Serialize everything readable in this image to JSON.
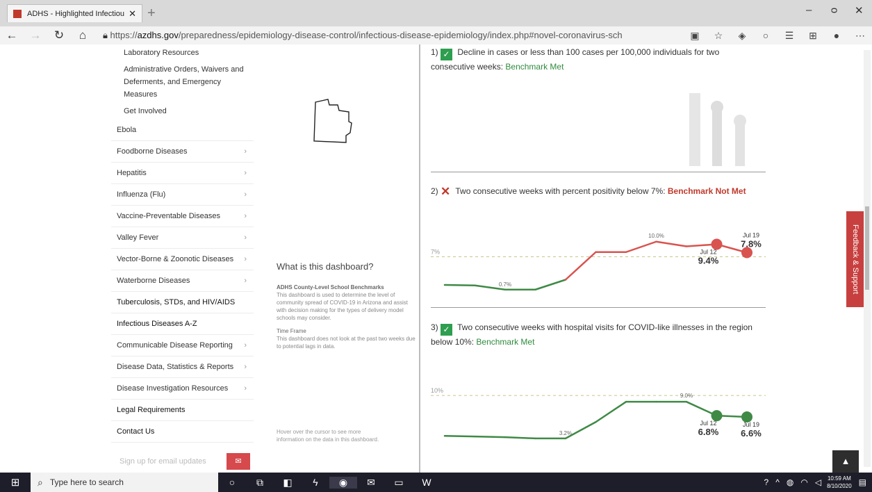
{
  "browser": {
    "tab_title": "ADHS - Highlighted Infectious D",
    "new_tab": "+",
    "url_prefix": "https://",
    "url_domain": "azdhs.gov",
    "url_rest": "/preparedness/epidemiology-disease-control/infectious-disease-epidemiology/index.php#novel-coronavirus-sch",
    "minimize": "–",
    "restore": "ᴑ",
    "close": "✕"
  },
  "sidebar": {
    "subitems": [
      "Laboratory Resources",
      "Administrative Orders, Waivers and Deferments, and Emergency Measures",
      "Get Involved"
    ],
    "items": [
      {
        "label": "Ebola",
        "chevron": ""
      },
      {
        "label": "Foodborne Diseases",
        "chevron": "›"
      },
      {
        "label": "Hepatitis",
        "chevron": "›"
      },
      {
        "label": "Influenza (Flu)",
        "chevron": "›"
      },
      {
        "label": "Vaccine-Preventable Diseases",
        "chevron": "›"
      },
      {
        "label": "Valley Fever",
        "chevron": "›"
      },
      {
        "label": "Vector-Borne & Zoonotic Diseases",
        "chevron": "›"
      },
      {
        "label": "Waterborne Diseases",
        "chevron": "›"
      },
      {
        "label": "Tuberculosis, STDs, and HIV/AIDS",
        "chevron": ""
      },
      {
        "label": "Infectious Diseases A-Z",
        "chevron": ""
      },
      {
        "label": "Communicable Disease Reporting",
        "chevron": "›"
      },
      {
        "label": "Disease Data, Statistics & Reports",
        "chevron": "›"
      },
      {
        "label": "Disease Investigation Resources",
        "chevron": "›"
      },
      {
        "label": "Legal Requirements",
        "chevron": ""
      },
      {
        "label": "Contact Us",
        "chevron": ""
      }
    ],
    "email_placeholder": "Sign up for email updates",
    "email_btn": "✉"
  },
  "dashboard": {
    "question": "What is this dashboard?",
    "info_heading": "ADHS County-Level School Benchmarks",
    "info_text": "This dashboard is used to determine the level of community spread of COVID-19 in Arizona and assist with decision making for the types of delivery model schools may consider.",
    "timeframe_heading": "Time Frame",
    "timeframe_text": "This dashboard does not look at the past two weeks due to potential lags in data.",
    "hover_text": "Hover over the cursor to see more information on the data in this dashboard."
  },
  "benchmarks": [
    {
      "num": "1)",
      "icon": "✓",
      "text": "Decline in cases or less than 100 cases per 100,000 individuals for two consecutive weeks:",
      "status": "Benchmark Met",
      "met": true
    },
    {
      "num": "2)",
      "icon": "✕",
      "text": "Two consecutive weeks with percent positivity below 7%:",
      "status": "Benchmark Not Met",
      "met": false
    },
    {
      "num": "3)",
      "icon": "✓",
      "text": "Two consecutive weeks with hospital visits for COVID-like illnesses in the region below 10%:",
      "status": "Benchmark Met",
      "met": true
    }
  ],
  "chart_data": [
    {
      "type": "line",
      "threshold_label": "7%",
      "threshold": 7,
      "ylim": [
        0,
        12
      ],
      "values": [
        1.6,
        1.5,
        0.7,
        0.7,
        2.6,
        7.9,
        7.9,
        9.9,
        9.0,
        9.4,
        7.8
      ],
      "labels": [
        {
          "index": 2,
          "text": "0.7%"
        },
        {
          "index": 7,
          "text": "10.0%"
        }
      ],
      "callouts": [
        {
          "index": 9,
          "date": "Jul 12",
          "value": "9.4%"
        },
        {
          "index": 10,
          "date": "Jul 19",
          "value": "7.8%"
        }
      ],
      "line_colors": {
        "below": "#3f8a45",
        "above": "#d9534f"
      }
    },
    {
      "type": "line",
      "threshold_label": "10%",
      "threshold": 10,
      "ylim": [
        0,
        11
      ],
      "values": [
        3.6,
        3.5,
        3.4,
        3.2,
        3.2,
        5.8,
        9.0,
        9.0,
        9.0,
        6.8,
        6.6
      ],
      "labels": [
        {
          "index": 4,
          "text": "3.2%"
        },
        {
          "index": 8,
          "text": "9.0%"
        }
      ],
      "callouts": [
        {
          "index": 9,
          "date": "Jul 12",
          "value": "6.8%"
        },
        {
          "index": 10,
          "date": "Jul 19",
          "value": "6.6%"
        }
      ],
      "line_colors": {
        "below": "#3f8a45",
        "above": "#3f8a45"
      }
    }
  ],
  "feedback": "Feedback & Support",
  "back_to_top": "▲",
  "taskbar": {
    "search_placeholder": "Type here to search",
    "time": "10:59 AM",
    "date": "8/10/2020"
  }
}
